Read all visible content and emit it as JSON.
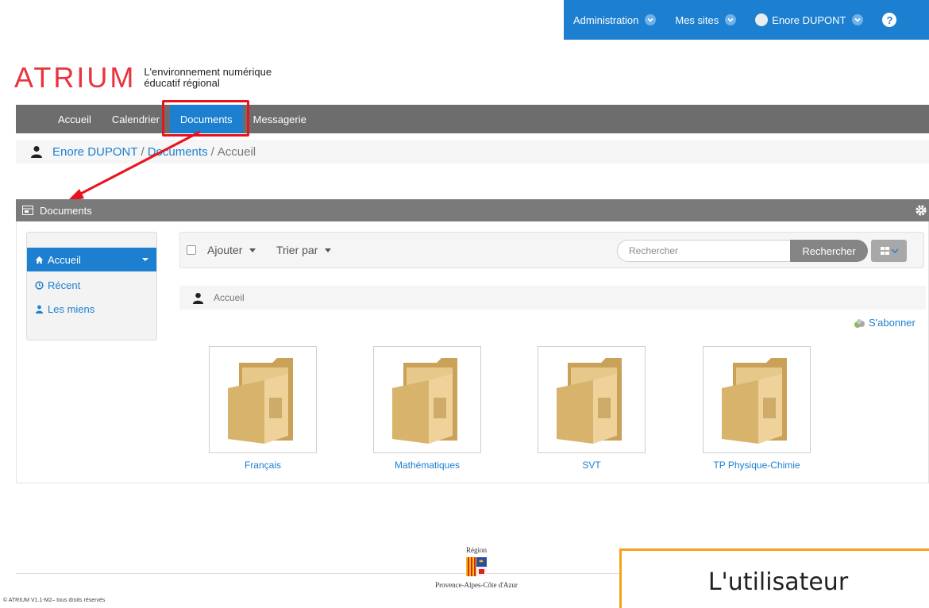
{
  "topbar": {
    "administration": "Administration",
    "mes_sites": "Mes sites",
    "user": "Enore DUPONT",
    "help": "?"
  },
  "logo": {
    "name": "ATRIUM",
    "tagline_line1": "L'environnement numérique",
    "tagline_line2": "éducatif régional"
  },
  "nav": {
    "items": [
      {
        "label": "Accueil"
      },
      {
        "label": "Calendrier"
      },
      {
        "label": "Documents"
      },
      {
        "label": "Messagerie"
      }
    ],
    "active_index": 2
  },
  "breadcrumb": {
    "user": "Enore DUPONT",
    "sep": "/",
    "section": "Documents",
    "current": "Accueil"
  },
  "portlet": {
    "title": "Documents"
  },
  "sidebar": {
    "items": [
      {
        "label": "Accueil",
        "icon": "home-icon"
      },
      {
        "label": "Récent",
        "icon": "clock-icon"
      },
      {
        "label": "Les miens",
        "icon": "user-icon"
      }
    ]
  },
  "toolbar": {
    "add": "Ajouter",
    "sort": "Trier par",
    "search_placeholder": "Rechercher",
    "search_button": "Rechercher"
  },
  "path": {
    "label": "Accueil"
  },
  "subscribe": "S'abonner",
  "folders": [
    {
      "label": "Français"
    },
    {
      "label": "Mathématiques"
    },
    {
      "label": "SVT"
    },
    {
      "label": "TP Physique-Chimie"
    }
  ],
  "footer": {
    "region_top": "Région",
    "region_bottom": "Provence-Alpes-Côte d'Azur",
    "copyright": "© ATRIUM V1.1-M2– tous droits réservés"
  },
  "callout": "L'utilisateur",
  "colors": {
    "primary_blue": "#1c7fd0",
    "logo_red": "#e7343f",
    "highlight_red": "#e8141d",
    "callout_orange": "#f5a21b"
  }
}
